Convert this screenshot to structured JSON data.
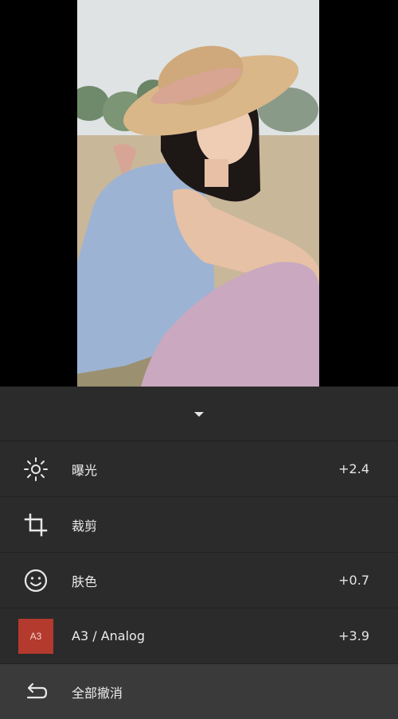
{
  "panel": {
    "adjustments": [
      {
        "icon": "exposure-sun-icon",
        "label": "曝光",
        "value": "+2.4"
      },
      {
        "icon": "crop-icon",
        "label": "裁剪",
        "value": ""
      },
      {
        "icon": "skin-tone-face-icon",
        "label": "肤色",
        "value": "+0.7"
      },
      {
        "icon": "preset-badge",
        "badge": "A3",
        "label": "A3 / Analog",
        "value": "+3.9"
      }
    ],
    "undo_label": "全部撤消"
  },
  "colors": {
    "panel_bg": "#2b2b2b",
    "preset_badge": "#b33a2c",
    "undo_row_bg": "#3a3a3a"
  }
}
